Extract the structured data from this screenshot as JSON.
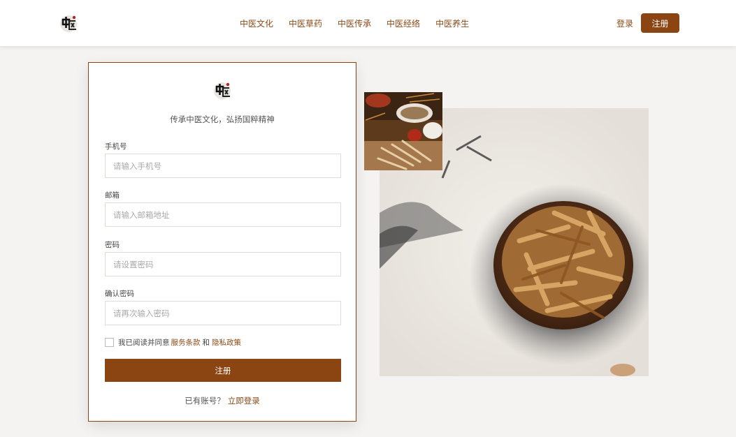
{
  "header": {
    "nav": [
      "中医文化",
      "中医草药",
      "中医传承",
      "中医经络",
      "中医养生"
    ],
    "login": "登录",
    "register": "注册"
  },
  "card": {
    "slogan": "传承中医文化，弘扬国粹精神",
    "fields": [
      {
        "label": "手机号",
        "placeholder": "请输入手机号",
        "value": ""
      },
      {
        "label": "邮箱",
        "placeholder": "请输入邮箱地址",
        "value": ""
      },
      {
        "label": "密码",
        "placeholder": "请设置密码",
        "value": ""
      },
      {
        "label": "确认密码",
        "placeholder": "请再次输入密码",
        "value": ""
      }
    ],
    "agree": {
      "prefix": "我已阅读并同意",
      "terms": "服务条款",
      "and": "和",
      "privacy": "隐私政策",
      "checked": false
    },
    "submit": "注册",
    "have_account": "已有账号？",
    "login_now": "立即登录"
  },
  "colors": {
    "accent": "#8b4513",
    "link": "#8b4a16",
    "background": "#f4f3f1"
  }
}
